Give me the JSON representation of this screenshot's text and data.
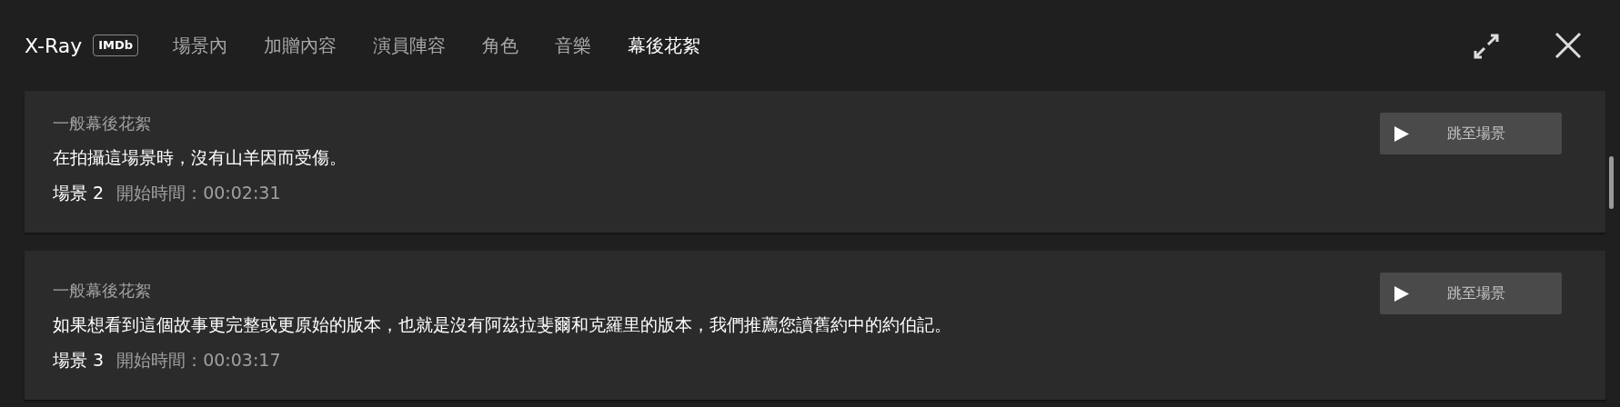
{
  "header": {
    "title": "X-Ray",
    "badge": "IMDb"
  },
  "tabs": [
    {
      "label": "場景內",
      "selected": false
    },
    {
      "label": "加贈內容",
      "selected": false
    },
    {
      "label": "演員陣容",
      "selected": false
    },
    {
      "label": "角色",
      "selected": false
    },
    {
      "label": "音樂",
      "selected": false
    },
    {
      "label": "幕後花絮",
      "selected": true
    }
  ],
  "items": [
    {
      "category": "一般幕後花絮",
      "text": "在拍攝這場景時，沒有山羊因而受傷。",
      "scene": "場景 2",
      "start_label": "開始時間：",
      "start_time": "00:02:31",
      "button": "跳至場景"
    },
    {
      "category": "一般幕後花絮",
      "text": "如果想看到這個故事更完整或更原始的版本，也就是沒有阿茲拉斐爾和克羅里的版本，我們推薦您讀舊約中的約伯記。",
      "scene": "場景 3",
      "start_label": "開始時間：",
      "start_time": "00:03:17",
      "button": "跳至場景"
    }
  ]
}
